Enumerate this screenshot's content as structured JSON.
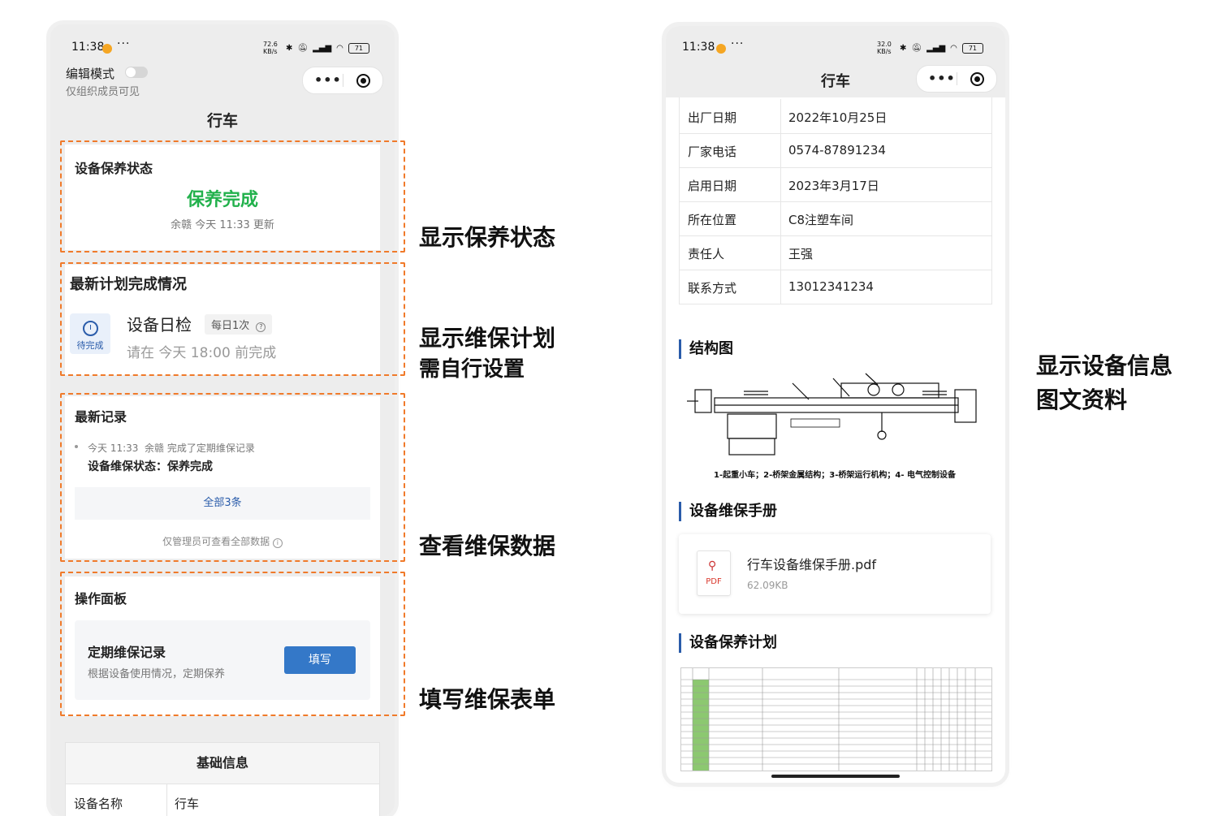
{
  "left_phone": {
    "status": {
      "time": "11:38",
      "more": "···",
      "speed": "72.6 KB/s",
      "battery": "71"
    },
    "edit_mode_label": "编辑模式",
    "edit_mode_sub": "仅组织成员可见",
    "title": "行车",
    "status_card": {
      "title": "设备保养状态",
      "value": "保养完成",
      "meta": "余赣 今天 11:33 更新",
      "value_color": "#22b14c"
    },
    "plan_card": {
      "title": "最新计划完成情况",
      "badge_text": "待完成",
      "task_name": "设备日检",
      "frequency": "每日1次",
      "deadline": "请在 今天 18:00 前完成"
    },
    "records_card": {
      "title": "最新记录",
      "record_meta": "今天 11:33  余赣 完成了定期维保记录",
      "record_content": "设备维保状态：保养完成",
      "all_button": "全部3条",
      "note": "仅管理员可查看全部数据"
    },
    "ops_card": {
      "title": "操作面板",
      "form_title": "定期维保记录",
      "form_desc": "根据设备使用情况，定期保养",
      "fill_button": "填写",
      "button_color": "#3478c8"
    },
    "basic_info": {
      "header": "基础信息",
      "rows": [
        {
          "k": "设备名称",
          "v": "行车"
        }
      ]
    }
  },
  "annotations": {
    "a1": "显示保养状态",
    "a2_line1": "显示维保计划",
    "a2_line2": "需自行设置",
    "a3": "查看维保数据",
    "a4": "填写维保表单",
    "a5_line1": "显示设备信息",
    "a5_line2": "图文资料"
  },
  "right_phone": {
    "status": {
      "time": "11:38",
      "more": "···",
      "speed": "32.0 KB/s",
      "battery": "71"
    },
    "title": "行车",
    "info_rows": [
      {
        "k": "出厂日期",
        "v": "2022年10月25日"
      },
      {
        "k": "厂家电话",
        "v": "0574-87891234"
      },
      {
        "k": "启用日期",
        "v": "2023年3月17日"
      },
      {
        "k": "所在位置",
        "v": "C8注塑车间"
      },
      {
        "k": "责任人",
        "v": "王强"
      },
      {
        "k": "联系方式",
        "v": "13012341234"
      }
    ],
    "structure_title": "结构图",
    "structure_caption": "1-起重小车；2-桥架金属结构；3-桥架运行机构；4- 电气控制设备",
    "manual_title": "设备维保手册",
    "file_name": "行车设备维保手册.pdf",
    "file_size": "62.09KB",
    "file_type": "PDF",
    "plan_title": "设备保养计划"
  }
}
